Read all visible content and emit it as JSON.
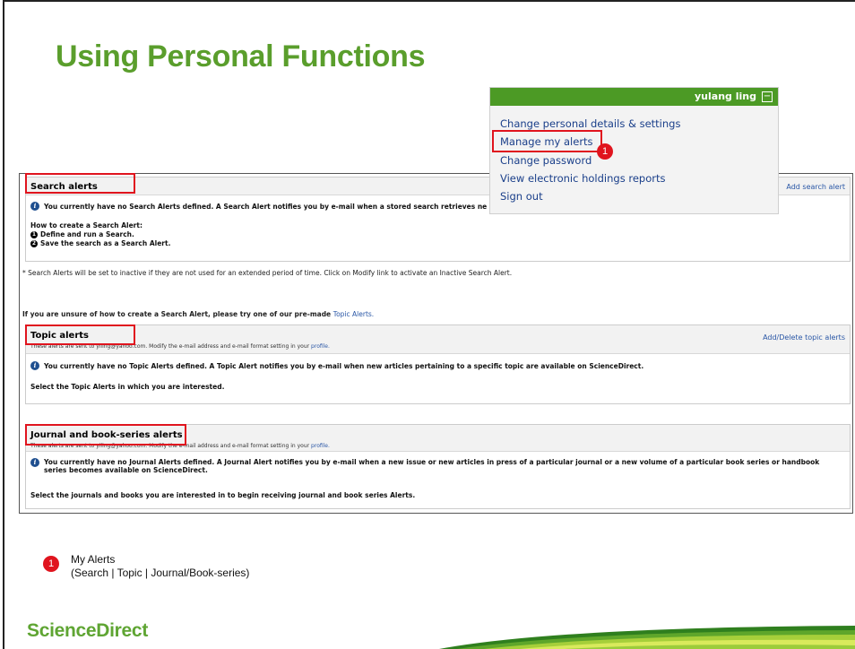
{
  "slide": {
    "title": "Using Personal Functions",
    "brand": "ScienceDirect"
  },
  "colors": {
    "accent_green": "#5a9e2c",
    "menu_green": "#4c9a25",
    "highlight_red": "#e0141e",
    "link_blue": "#1a3f8a"
  },
  "dropdown": {
    "user": "yulang ling",
    "toggle_icon": "collapse-icon",
    "items": [
      {
        "label": "Change personal details & settings"
      },
      {
        "label": "Manage my alerts"
      },
      {
        "label": "Change password"
      },
      {
        "label": "View electronic holdings reports"
      },
      {
        "label": "Sign out"
      }
    ]
  },
  "search_alerts": {
    "title": "Search alerts",
    "action": "Add search alert",
    "info": "You currently have no Search Alerts defined. A Search Alert notifies you by e-mail when a stored search retrieves ne",
    "how_title": "How to create a Search Alert:",
    "steps": [
      {
        "num": "1",
        "text": "Define and run a Search."
      },
      {
        "num": "2",
        "text": "Save the search as a Search Alert."
      }
    ],
    "note": "* Search Alerts will be set to inactive if they are not used for an extended period of time. Click on Modify link to activate an Inactive Search Alert.",
    "premade_prefix": "If you are unsure of how to create a Search Alert, please try one of our pre-made",
    "premade_link": "Topic Alerts."
  },
  "topic_alerts": {
    "title": "Topic alerts",
    "sub_prefix": "These alerts are sent to yiling@yahoo.com. Modify the e-mail address and e-mail format setting in your",
    "sub_link": "profile.",
    "action": "Add/Delete topic alerts",
    "info": "You currently have no Topic Alerts defined. A Topic Alert notifies you by e-mail when new articles pertaining to a specific topic are available on ScienceDirect.",
    "select_text": "Select the Topic Alerts in which you are interested."
  },
  "journal_alerts": {
    "title": "Journal and book-series alerts",
    "sub_prefix": "These alerts are sent to yiling@yahoo.com. Modify the e-mail address and e-mail format setting in your",
    "sub_link": "profile.",
    "info_line1": "You currently have no Journal Alerts defined. A Journal Alert notifies you by e-mail when a new issue or new articles in press of a particular journal or a new volume of a particular book series or handbook",
    "info_line2": "series becomes available on ScienceDirect.",
    "select_text": "Select the journals and books you are interested in to begin receiving journal and book series Alerts."
  },
  "legend": {
    "badge": "1",
    "line1": "My Alerts",
    "line2": "(Search | Topic | Journal/Book-series)"
  }
}
